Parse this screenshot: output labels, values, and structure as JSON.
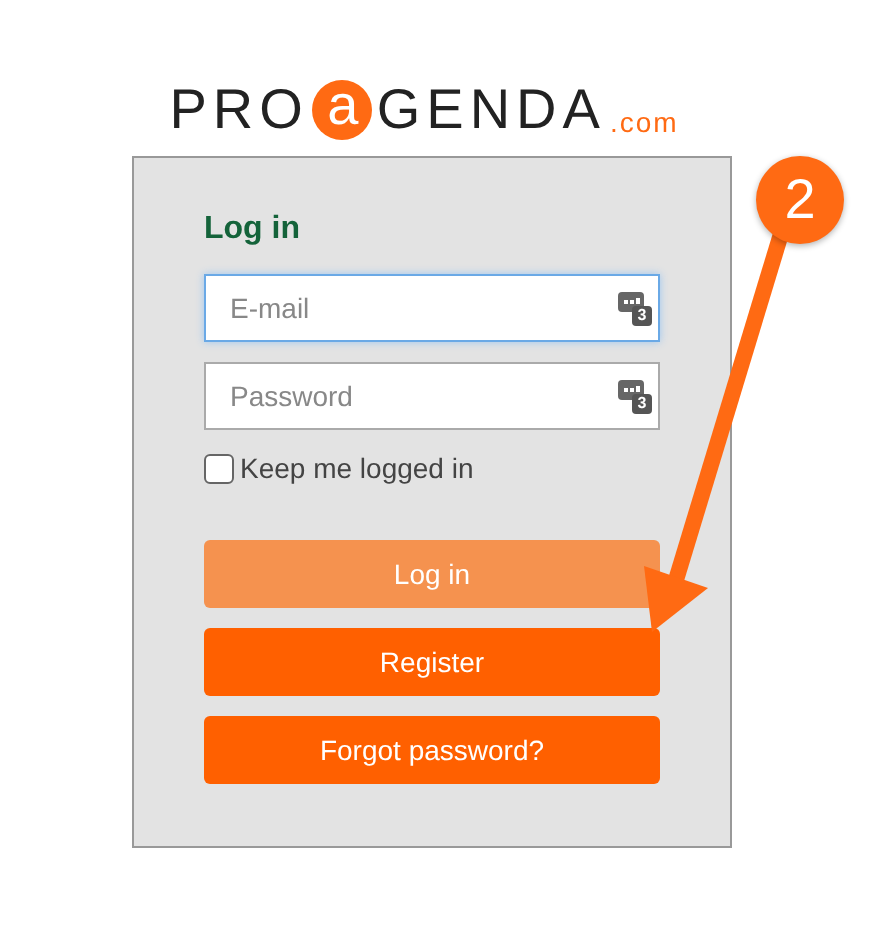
{
  "logo": {
    "before": "PRO",
    "mark": "a",
    "after": "GENDA",
    "suffix": ".com"
  },
  "form": {
    "title": "Log in",
    "fields": [
      {
        "placeholder": "E-mail",
        "focused": true,
        "badge": "3"
      },
      {
        "placeholder": "Password",
        "focused": false,
        "badge": "3"
      }
    ],
    "remember": {
      "label": "Keep me logged in",
      "checked": false
    },
    "buttons": [
      {
        "label": "Log in",
        "disabled": true
      },
      {
        "label": "Register",
        "disabled": false
      },
      {
        "label": "Forgot password?",
        "disabled": false
      }
    ]
  },
  "annotation": {
    "step": "2"
  }
}
